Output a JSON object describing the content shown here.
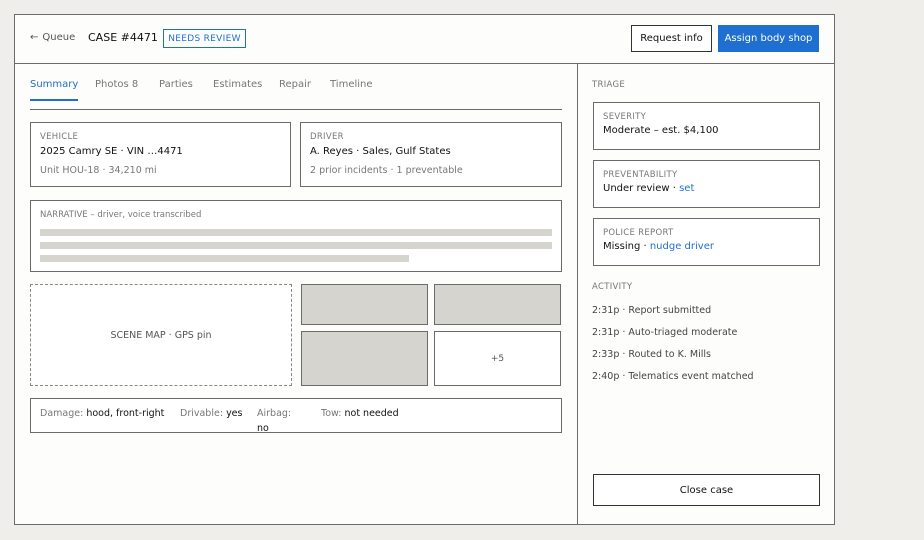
{
  "header": {
    "back_label": "Queue",
    "case_id": "CASE #4471",
    "status_badge": "NEEDS REVIEW",
    "request_info_label": "Request info",
    "assign_label": "Assign body shop"
  },
  "tabs": [
    "Summary",
    "Photos 8",
    "Parties",
    "Estimates",
    "Repair",
    "Timeline"
  ],
  "vehicle": {
    "label": "VEHICLE",
    "model": "2025 Camry SE · VIN …4471",
    "unit": "Unit HOU-18 · 34,210 mi"
  },
  "driver": {
    "label": "DRIVER",
    "name": "A. Reyes · Sales, Gulf States",
    "history": "2 prior incidents · 1 preventable"
  },
  "narrative": {
    "label": "NARRATIVE – driver, voice transcribed"
  },
  "scene_map": "SCENE MAP · GPS pin",
  "photos_more": "+5",
  "facts": {
    "damage_label": "Damage:",
    "damage_value": "hood, front-right",
    "drivable_label": "Drivable:",
    "drivable_value": "yes",
    "airbag_label": "Airbag:",
    "airbag_value": "no",
    "tow_label": "Tow:",
    "tow_value": "not needed"
  },
  "triage": {
    "title": "TRIAGE",
    "severity_label": "SEVERITY",
    "severity_value": "Moderate – est. $4,100",
    "preventability_label": "PREVENTABILITY",
    "preventability_value": "Under review ·",
    "preventability_link": "set",
    "police_label": "POLICE REPORT",
    "police_value": "Missing ·",
    "police_link": "nudge driver"
  },
  "activity": {
    "title": "ACTIVITY",
    "items": [
      "2:31p · Report submitted",
      "2:31p · Auto-triaged moderate",
      "2:33p · Routed to K. Mills",
      "2:40p · Telematics event matched"
    ]
  },
  "close_label": "Close case",
  "colors": {
    "accent": "#1f6fd1",
    "placeholder": "#d6d4cf",
    "border": "#6b6b6b"
  }
}
